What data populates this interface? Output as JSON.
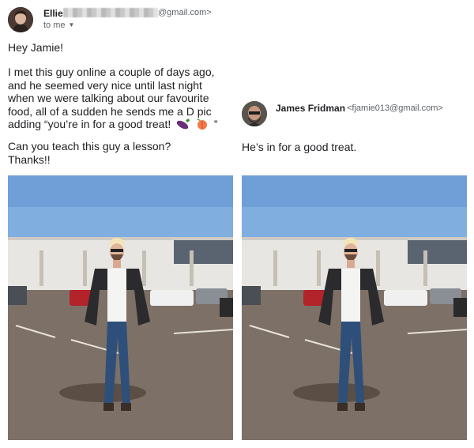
{
  "email": {
    "sender": {
      "name": "Ellie",
      "email_suffix": "@gmail.com>"
    },
    "recipient_line": "to me",
    "greeting": "Hey Jamie!",
    "body_lines": [
      "I met this guy online a couple of days ago,",
      "and he seemed very nice until last night",
      "when we were talking about our favourite",
      "food, all of a sudden he sends me a D pic",
      "adding “you’re in for a good treat!"
    ],
    "body_line_end": "”",
    "closing_lines": [
      "Can you teach this guy a lesson?",
      "Thanks!!"
    ]
  },
  "reply": {
    "sender": {
      "name": "James Fridman",
      "email": "<fjamie013@gmail.com>"
    },
    "text": "He’s in for a good treat."
  },
  "icons": [
    "eggplant-emoji-icon",
    "peach-emoji-icon",
    "chevron-down-icon"
  ]
}
